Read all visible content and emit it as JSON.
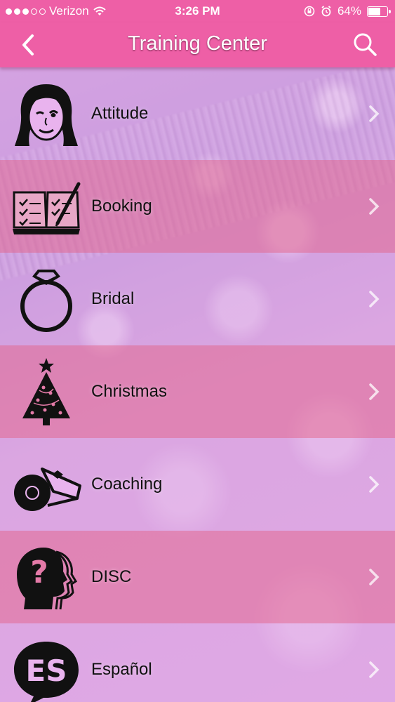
{
  "status_bar": {
    "carrier": "Verizon",
    "time": "3:26 PM",
    "battery": "64%",
    "battery_level": 0.64,
    "signal_bars_filled": 3,
    "signal_bars_total": 5
  },
  "nav": {
    "title": "Training Center",
    "back_icon": "chevron-left-icon",
    "search_icon": "search-icon",
    "bar_color": "#ee5fa6"
  },
  "list": {
    "items": [
      {
        "label": "Attitude",
        "icon": "woman-winking-face-icon"
      },
      {
        "label": "Booking",
        "icon": "open-book-checklist-icon"
      },
      {
        "label": "Bridal",
        "icon": "diamond-ring-icon"
      },
      {
        "label": "Christmas",
        "icon": "christmas-tree-icon"
      },
      {
        "label": "Coaching",
        "icon": "whistle-icon"
      },
      {
        "label": "DISC",
        "icon": "head-question-mark-icon"
      },
      {
        "label": "Español",
        "icon": "es-speech-bubble-icon"
      }
    ],
    "row_colors": {
      "odd": "#e9aff0",
      "even": "#e47aa8"
    }
  }
}
